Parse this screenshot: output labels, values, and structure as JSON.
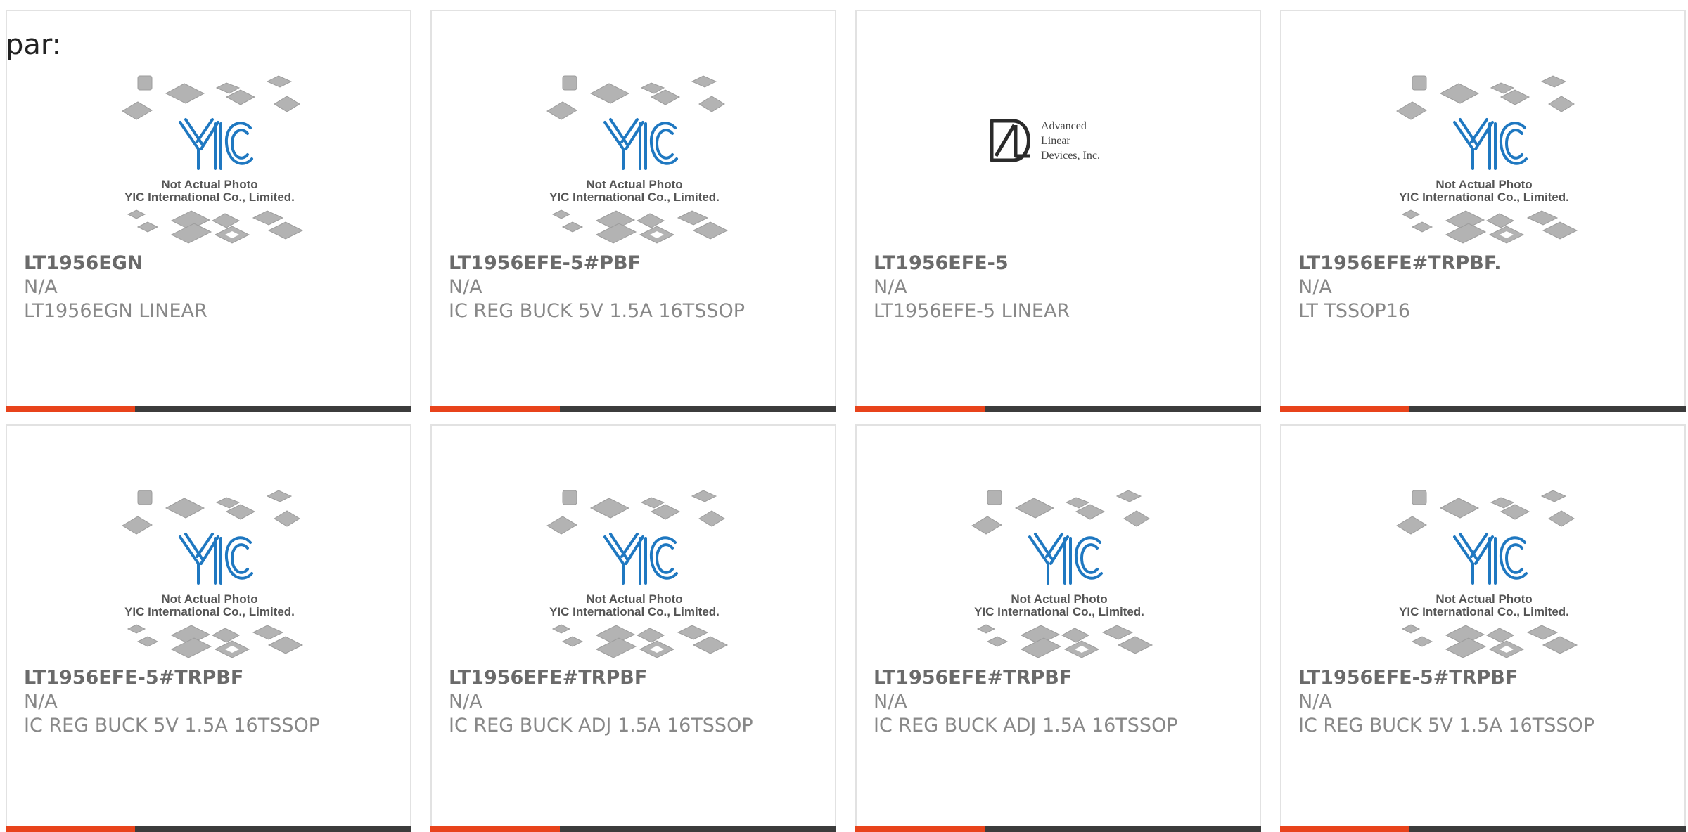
{
  "page": {
    "label": "par:"
  },
  "colors": {
    "accent": "#e8431b",
    "bar": "#3c3c3c",
    "logo_blue": "#1f78c1",
    "chip_gray": "#b3b3b3"
  },
  "placeholder": {
    "line1": "Not Actual Photo",
    "line2": "YIC International Co., Limited.",
    "logo": "YIC"
  },
  "ald_logo": {
    "l1": "Advanced",
    "l2": "Linear",
    "l3": "Devices, Inc."
  },
  "products": [
    {
      "part": "LT1956EGN",
      "mfr": "N/A",
      "desc": "LT1956EGN LINEAR",
      "image": "yic-placeholder"
    },
    {
      "part": "LT1956EFE-5#PBF",
      "mfr": "N/A",
      "desc": "IC REG BUCK 5V 1.5A 16TSSOP",
      "image": "yic-placeholder"
    },
    {
      "part": "LT1956EFE-5",
      "mfr": "N/A",
      "desc": "LT1956EFE-5 LINEAR",
      "image": "ald-logo"
    },
    {
      "part": "LT1956EFE#TRPBF.",
      "mfr": "N/A",
      "desc": "LT TSSOP16",
      "image": "yic-placeholder"
    },
    {
      "part": "LT1956EFE-5#TRPBF",
      "mfr": "N/A",
      "desc": "IC REG BUCK 5V 1.5A 16TSSOP",
      "image": "yic-placeholder"
    },
    {
      "part": "LT1956EFE#TRPBF",
      "mfr": "N/A",
      "desc": "IC REG BUCK ADJ 1.5A 16TSSOP",
      "image": "yic-placeholder"
    },
    {
      "part": "LT1956EFE#TRPBF",
      "mfr": "N/A",
      "desc": "IC REG BUCK ADJ 1.5A 16TSSOP",
      "image": "yic-placeholder"
    },
    {
      "part": "LT1956EFE-5#TRPBF",
      "mfr": "N/A",
      "desc": "IC REG BUCK 5V 1.5A 16TSSOP",
      "image": "yic-placeholder"
    }
  ]
}
